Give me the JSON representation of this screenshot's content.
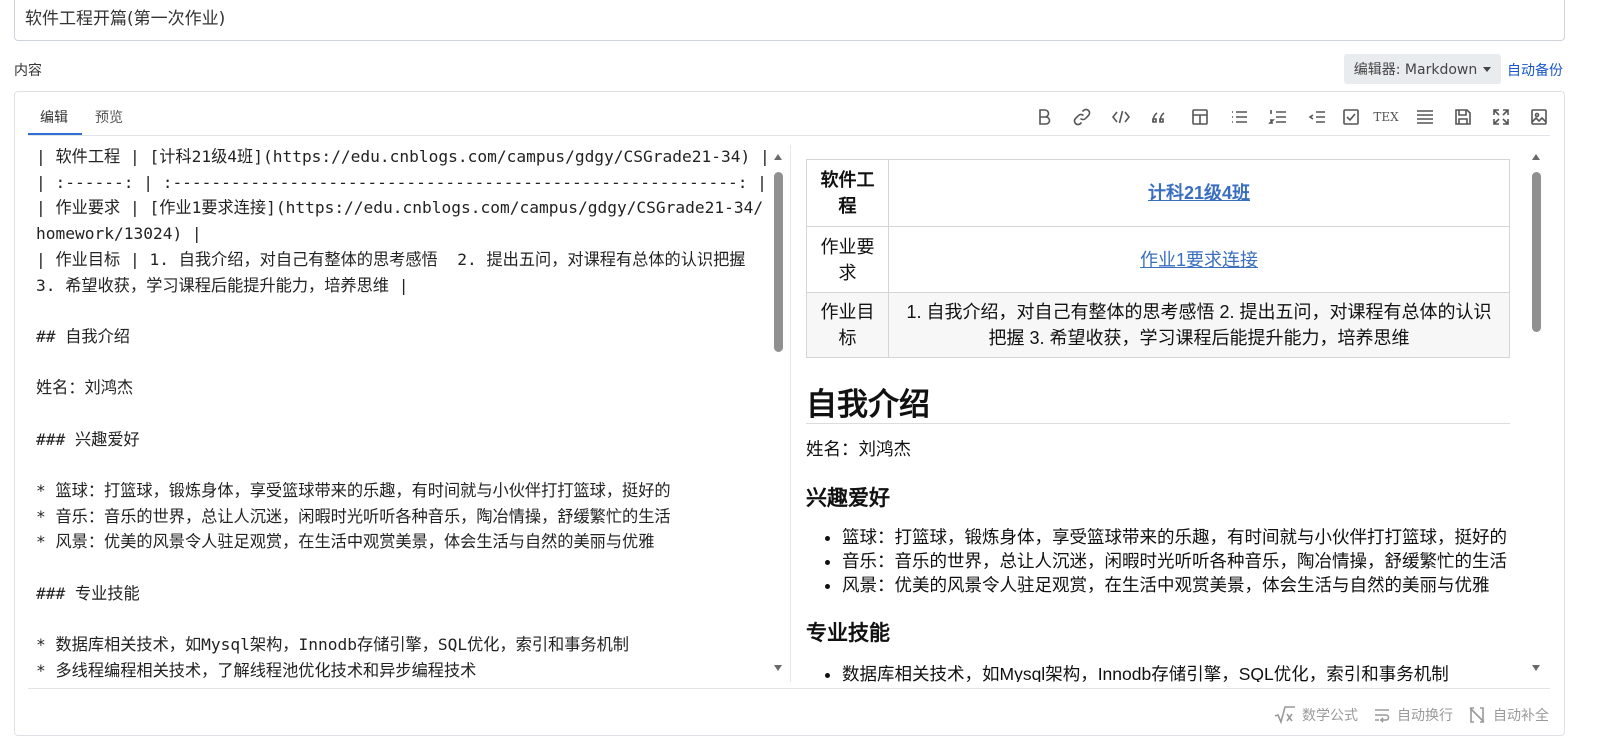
{
  "title_input": {
    "value": "软件工程开篇(第一次作业)"
  },
  "content_label": "内容",
  "editor_select": {
    "label": "编辑器: Markdown"
  },
  "auto_backup": "自动备份",
  "tabs": [
    {
      "label": "编辑"
    },
    {
      "label": "预览"
    }
  ],
  "toolbar": [
    "bold-icon",
    "link-icon",
    "code-icon",
    "quote-icon",
    "table-icon",
    "bulleted-list-icon",
    "numbered-list-icon",
    "outdent-icon",
    "checkbox-icon",
    "tex-icon",
    "justify-icon",
    "save-icon",
    "fullscreen-icon",
    "image-icon"
  ],
  "toolbar_tex": "TEX",
  "source_lines": [
    "| 软件工程 | [计科21级4班](https://edu.cnblogs.com/campus/gdgy/CSGrade21-34) |",
    "| :------: | :----------------------------------------------------------: |",
    "| 作业要求 | [作业1要求连接](https://edu.cnblogs.com/campus/gdgy/CSGrade21-34/homework/13024) |",
    "| 作业目标 | 1. 自我介绍，对自己有整体的思考感悟  2. 提出五问，对课程有总体的认识把握 3. 希望收获，学习课程后能提升能力，培养思维 |",
    "",
    "## 自我介绍",
    "",
    "姓名：刘鸿杰",
    "",
    "### 兴趣爱好",
    "",
    "* 篮球：打篮球，锻炼身体，享受篮球带来的乐趣，有时间就与小伙伴打打篮球，挺好的",
    "* 音乐：音乐的世界，总让人沉迷，闲暇时光听听各种音乐，陶冶情操，舒缓繁忙的生活",
    "* 风景：优美的风景令人驻足观赏，在生活中观赏美景，体会生活与自然的美丽与优雅",
    "",
    "### 专业技能",
    "",
    "* 数据库相关技术，如Mysql架构，Innodb存储引擎，SQL优化，索引和事务机制",
    "* 多线程编程相关技术，了解线程池优化技术和异步编程技术"
  ],
  "preview": {
    "table": {
      "header": {
        "label": "软件工程",
        "link": "计科21级4班"
      },
      "rows": [
        {
          "label": "作业要求",
          "link": "作业1要求连接"
        },
        {
          "label": "作业目标",
          "text": "1. 自我介绍，对自己有整体的思考感悟 2. 提出五问，对课程有总体的认识把握 3. 希望收获，学习课程后能提升能力，培养思维"
        }
      ]
    },
    "h2": "自我介绍",
    "name_line": "姓名：刘鸿杰",
    "hobbies_title": "兴趣爱好",
    "hobbies": [
      "篮球：打篮球，锻炼身体，享受篮球带来的乐趣，有时间就与小伙伴打打篮球，挺好的",
      "音乐：音乐的世界，总让人沉迷，闲暇时光听听各种音乐，陶冶情操，舒缓繁忙的生活",
      "风景：优美的风景令人驻足观赏，在生活中观赏美景，体会生活与自然的美丽与优雅"
    ],
    "skills_title": "专业技能",
    "skills": [
      "数据库相关技术，如Mysql架构，Innodb存储引擎，SQL优化，索引和事务机制"
    ]
  },
  "status_bar": {
    "math": "数学公式",
    "wrap": "自动换行",
    "complete": "自动补全"
  },
  "colors": {
    "accent": "#2f6fd1",
    "link": "#3a6fbf",
    "auto_backup": "#1a55c9"
  }
}
